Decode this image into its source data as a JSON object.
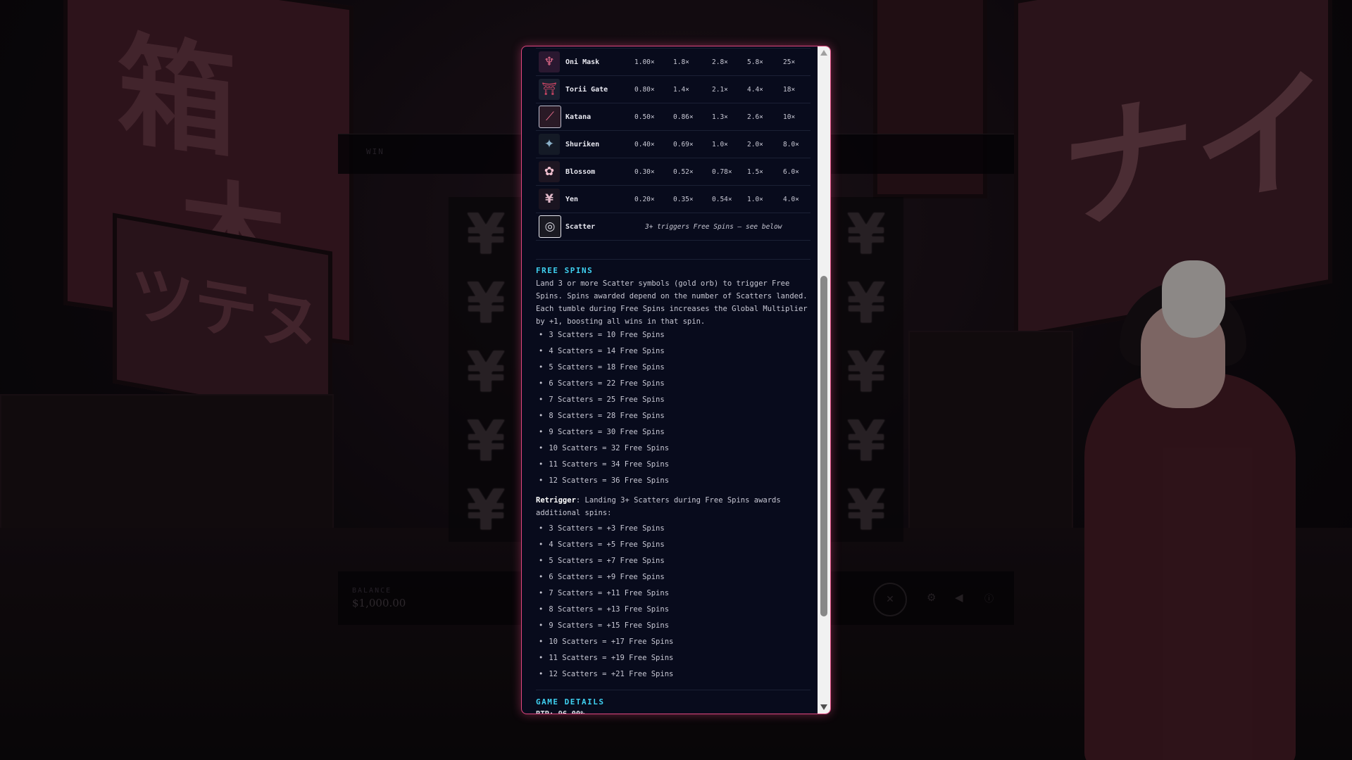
{
  "game": {
    "win_label": "WIN",
    "balance_label": "BALANCE",
    "balance_value": "$1,000.00",
    "reel_symbol": "¥"
  },
  "paytable": [
    {
      "name": "Oni Mask",
      "icon": "oni-mask-icon",
      "pays": [
        "1.00×",
        "1.8×",
        "2.8×",
        "5.8×",
        "25×"
      ]
    },
    {
      "name": "Torii Gate",
      "icon": "torii-gate-icon",
      "pays": [
        "0.80×",
        "1.4×",
        "2.1×",
        "4.4×",
        "18×"
      ]
    },
    {
      "name": "Katana",
      "icon": "katana-icon",
      "pays": [
        "0.50×",
        "0.86×",
        "1.3×",
        "2.6×",
        "10×"
      ]
    },
    {
      "name": "Shuriken",
      "icon": "shuriken-icon",
      "pays": [
        "0.40×",
        "0.69×",
        "1.0×",
        "2.0×",
        "8.0×"
      ]
    },
    {
      "name": "Blossom",
      "icon": "blossom-icon",
      "pays": [
        "0.30×",
        "0.52×",
        "0.78×",
        "1.5×",
        "6.0×"
      ]
    },
    {
      "name": "Yen",
      "icon": "yen-icon",
      "pays": [
        "0.20×",
        "0.35×",
        "0.54×",
        "1.0×",
        "4.0×"
      ]
    }
  ],
  "scatter": {
    "name": "Scatter",
    "note": "3+ triggers Free Spins — see below"
  },
  "free_spins": {
    "title": "FREE SPINS",
    "description": "Land 3 or more Scatter symbols (gold orb) to trigger Free Spins. Spins awarded depend on the number of Scatters landed. Each tumble during Free Spins increases the Global Multiplier by +1, boosting all wins in that spin.",
    "awards": [
      "3 Scatters = 10 Free Spins",
      "4 Scatters = 14 Free Spins",
      "5 Scatters = 18 Free Spins",
      "6 Scatters = 22 Free Spins",
      "7 Scatters = 25 Free Spins",
      "8 Scatters = 28 Free Spins",
      "9 Scatters = 30 Free Spins",
      "10 Scatters = 32 Free Spins",
      "11 Scatters = 34 Free Spins",
      "12 Scatters = 36 Free Spins"
    ],
    "retrigger_label": "Retrigger",
    "retrigger_text": ": Landing 3+ Scatters during Free Spins awards additional spins:",
    "retrigger_awards": [
      "3 Scatters = +3 Free Spins",
      "4 Scatters = +5 Free Spins",
      "5 Scatters = +7 Free Spins",
      "6 Scatters = +9 Free Spins",
      "7 Scatters = +11 Free Spins",
      "8 Scatters = +13 Free Spins",
      "9 Scatters = +15 Free Spins",
      "10 Scatters = +17 Free Spins",
      "11 Scatters = +19 Free Spins",
      "12 Scatters = +21 Free Spins"
    ]
  },
  "game_details": {
    "title": "GAME DETAILS",
    "partial_text": "RTP: 96.00%"
  },
  "colors": {
    "accent": "#3fd1f1",
    "border": "#e0467f",
    "panel": "#080b1c"
  }
}
